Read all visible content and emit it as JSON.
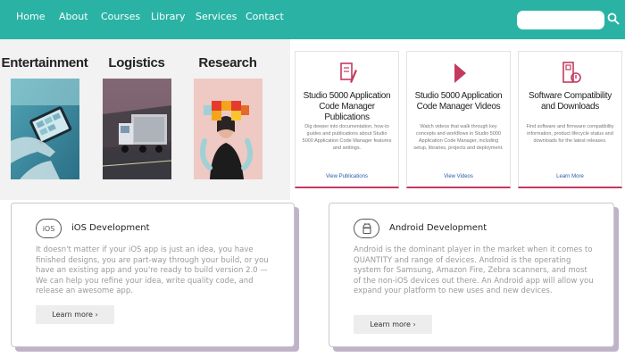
{
  "nav": {
    "links": [
      "Home",
      "About",
      "Courses",
      "Library",
      "Services",
      "Contact"
    ],
    "search_icon": "search-icon"
  },
  "categories": [
    {
      "label": "Entertainment",
      "image": "person-using-tablet"
    },
    {
      "label": "Logistics",
      "image": "truck-in-warehouse"
    },
    {
      "label": "Research",
      "image": "person-holding-colorful-cubes"
    }
  ],
  "resources": [
    {
      "icon": "document-pencil-icon",
      "title": "Studio 5000 Application Code Manager Publications",
      "description": "Dig deeper into documentation, how-to guides and publications about Studio 5000 Application Code Manager features and settings.",
      "link": "View Publications"
    },
    {
      "icon": "play-icon",
      "title": "Studio 5000 Application Code Manager Videos",
      "description": "Watch videos that walk through key concepts and workflows in Studio 5000 Application Code Manager, including setup, libraries, projects and deployment.",
      "link": "View Videos"
    },
    {
      "icon": "compatibility-doc-icon",
      "title": "Software Compatibility and Downloads",
      "description": "Find software and firmware compatibility information, product lifecycle status and downloads for the latest releases.",
      "link": "Learn More"
    }
  ],
  "dev_cards": [
    {
      "icon": "ios-icon",
      "icon_text": "iOS",
      "title": "iOS Development",
      "description": "It doesn't matter if your iOS app is just an idea, you have finished designs, you are part-way through your build, or you have an existing app and you're ready to build version 2.0 — We can help you refine your idea, write quality code, and release an awesome app.",
      "button": "Learn more ›"
    },
    {
      "icon": "android-icon",
      "title": "Android Development",
      "description": "Android is the dominant player in the market when it comes to QUANTITY and range of devices. Android is the operating system for Samsung, Amazon Fire, Zebra scanners, and most of the non-iOS devices out there. An Android app will allow you expand your platform to new uses and new devices.",
      "button": "Learn more ›"
    }
  ],
  "colors": {
    "nav": "#2ab3a5",
    "accent": "#c43a5f",
    "link": "#2a58a8"
  }
}
